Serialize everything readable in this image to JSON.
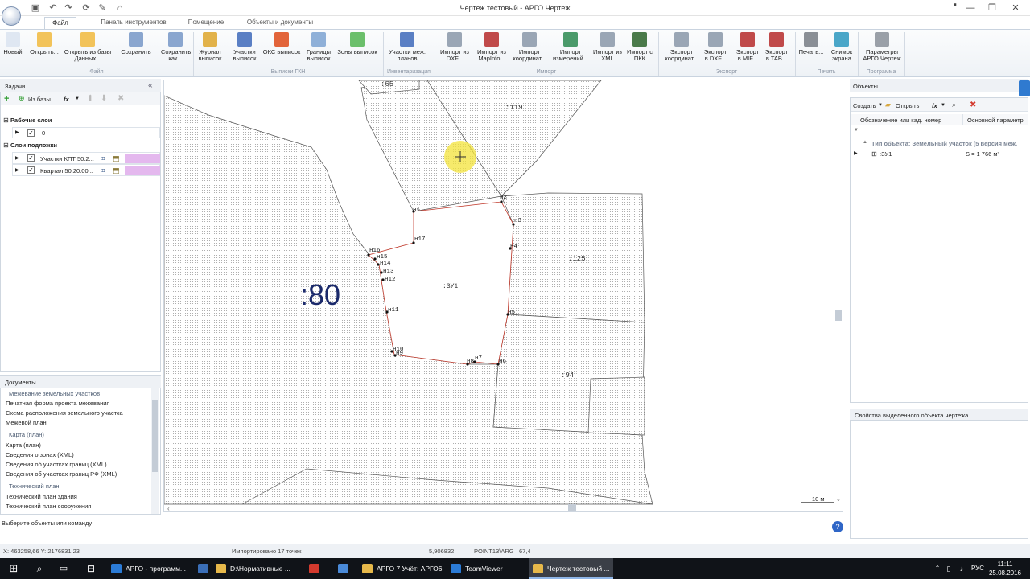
{
  "window": {
    "title": "Чертеж тестовый - АРГО Чертеж"
  },
  "tabs": [
    "Файл",
    "Панель инструментов",
    "Помещение",
    "Объекты и документы"
  ],
  "ribbon": {
    "buttons": [
      {
        "label": "Новый",
        "color": "#dfe7f2"
      },
      {
        "label": "Открыть...",
        "color": "#f2c35a"
      },
      {
        "label": "Открыть из базы Данных...",
        "color": "#f2c35a"
      },
      {
        "label": "Сохранить",
        "color": "#8aa6cf"
      },
      {
        "label": "Сохранить как...",
        "color": "#8aa6cf"
      },
      {
        "label": "Журнал выписок",
        "color": "#e2b24a"
      },
      {
        "label": "Участки выписок",
        "color": "#5a7fc4"
      },
      {
        "label": "ОКС выписок",
        "color": "#e2643a"
      },
      {
        "label": "Границы выписок",
        "color": "#8fb0d8"
      },
      {
        "label": "Зоны выписок",
        "color": "#6bbf6b"
      },
      {
        "label": "Участки меж. планов",
        "color": "#5a7fc4"
      },
      {
        "label": "Импорт из DXF...",
        "color": "#9aa6b5"
      },
      {
        "label": "Импорт из MapInfo...",
        "color": "#c04a4a"
      },
      {
        "label": "Импорт координат...",
        "color": "#9aa6b5"
      },
      {
        "label": "Импорт измерений...",
        "color": "#4a9a6a"
      },
      {
        "label": "Импорт из XML",
        "color": "#9aa6b5"
      },
      {
        "label": "Импорт с ПКК",
        "color": "#4a7a4a"
      },
      {
        "label": "Экспорт координат...",
        "color": "#9aa6b5"
      },
      {
        "label": "Экспорт в DXF...",
        "color": "#9aa6b5"
      },
      {
        "label": "Экспорт в MIF...",
        "color": "#c04a4a"
      },
      {
        "label": "Экспорт в TAB...",
        "color": "#c04a4a"
      },
      {
        "label": "Печать...",
        "color": "#8a8f96"
      },
      {
        "label": "Снимок экрана",
        "color": "#4aa6c8"
      },
      {
        "label": "Параметры АРГО Чертеж",
        "color": "#9aa0a8"
      }
    ],
    "groups": [
      "Файл",
      "Выписки ГКН",
      "Инвентаризация",
      "Импорт",
      "Экспорт",
      "Печать",
      "Программа"
    ]
  },
  "tasks_panel": {
    "title": "Задачи",
    "toolbar": {
      "from_db": "Из базы",
      "fx": "fx"
    },
    "work_layers_title": "Рабочие слои",
    "work_layer": "0",
    "base_layers_title": "Слои подложки",
    "base_layers": [
      "Участки КПТ 50:2...",
      "Квартал 50:20:00..."
    ]
  },
  "documents_panel": {
    "title": "Документы",
    "groups": [
      {
        "header": "Межевание земельных участков",
        "items": [
          "Печатная форма проекта межевания",
          "Схема расположения земельного участка",
          "Межевой план"
        ]
      },
      {
        "header": "Карта (план)",
        "items": [
          "Карта (план)",
          "Сведения о зонах (XML)",
          "Сведения об участках границ (XML)",
          "Сведения об участках границ РФ (XML)"
        ]
      },
      {
        "header": "Технический план",
        "items": [
          "Технический план здания",
          "Технический план сооружения"
        ]
      }
    ]
  },
  "command_prompt": "Выберите объекты или команду",
  "canvas": {
    "big_label": ":80",
    "parcel_labels": [
      ":65",
      ":119",
      ":125",
      ":94",
      ":ЗУ1"
    ],
    "point_labels": [
      "н1",
      "н2",
      "н3",
      "н4",
      "н5",
      "н6",
      "н7",
      "н8",
      "н9",
      "н10",
      "н11",
      "н12",
      "н13",
      "н14",
      "н15",
      "н16",
      "н17"
    ],
    "scale_label": "10 м"
  },
  "objects_panel": {
    "title": "Объекты",
    "toolbar": {
      "create": "Создать",
      "open": "Открыть",
      "fx": "fx"
    },
    "columns": [
      "Обозначение или кад. номер",
      "Основной параметр"
    ],
    "group_row": "Тип объекта: Земельный участок (5 версия меж.",
    "rows": [
      {
        "name": ":ЗУ1",
        "param": "S = 1 766 м²"
      }
    ]
  },
  "properties_panel": {
    "title": "Свойства выделенного объекта чертежа"
  },
  "status": {
    "coords": "X: 463258,66 Y: 2176831,23",
    "message": "Импортировано 17 точек",
    "value1": "5,906832",
    "value2": "POINT13\\ARG",
    "value3": "67,4"
  },
  "taskbar": {
    "items": [
      {
        "label": "АРГО - программ...",
        "color": "#2b7bd6"
      },
      {
        "label": "",
        "color": "#3b6fb8"
      },
      {
        "label": "D:\\Нормативные ...",
        "color": "#e6b84a"
      },
      {
        "label": "",
        "color": "#d33a2e"
      },
      {
        "label": "",
        "color": "#4a8ad8"
      },
      {
        "label": "АРГО 7 Учёт: АРГО6",
        "color": "#e6b84a"
      },
      {
        "label": "TeamViewer",
        "color": "#2b7bd6"
      },
      {
        "label": "Чертеж тестовый ...",
        "color": "#e6b84a"
      }
    ],
    "lang": "РУС",
    "time": "11:11",
    "date": "25.08.2016"
  }
}
